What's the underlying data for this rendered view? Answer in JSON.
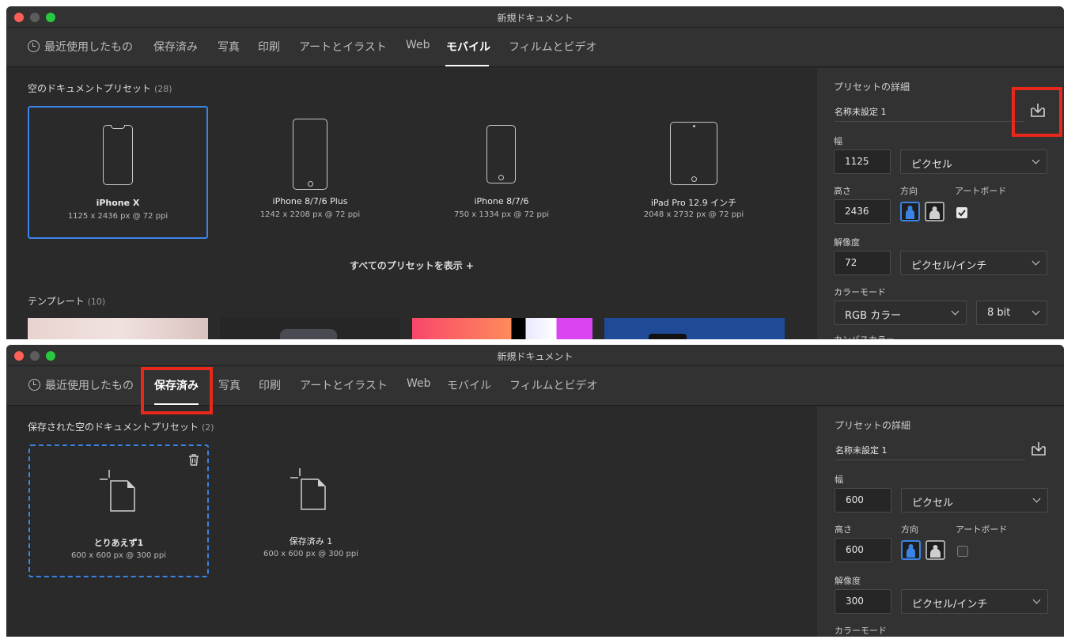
{
  "colors": {
    "accent": "#3a84e6",
    "highlight": "#e8281b"
  },
  "top": {
    "window_title": "新規ドキュメント",
    "tabs": [
      {
        "label": "最近使用したもの"
      },
      {
        "label": "保存済み"
      },
      {
        "label": "写真"
      },
      {
        "label": "印刷"
      },
      {
        "label": "アートとイラスト"
      },
      {
        "label": "Web"
      },
      {
        "label": "モバイル",
        "active": true
      },
      {
        "label": "フィルムとビデオ"
      }
    ],
    "section_title": "空のドキュメントプリセット",
    "section_count": "(28)",
    "presets": [
      {
        "name": "iPhone X",
        "size": "1125 x 2436 px @ 72 ppi",
        "selected": true,
        "icon": "iphone-x-icon"
      },
      {
        "name": "iPhone 8/7/6 Plus",
        "size": "1242 x 2208 px @ 72 ppi",
        "icon": "iphone-plus-icon"
      },
      {
        "name": "iPhone 8/7/6",
        "size": "750 x 1334 px @ 72 ppi",
        "icon": "iphone-icon"
      },
      {
        "name": "iPad Pro 12.9 インチ",
        "size": "2048 x 2732 px @ 72 ppi",
        "icon": "ipad-icon"
      }
    ],
    "show_all": "すべてのプリセットを表示 +",
    "templates_title": "テンプレート",
    "templates_count": "(10)",
    "panel": {
      "title": "プリセットの詳細",
      "name": "名称未設定 1",
      "width_label": "幅",
      "width": "1125",
      "width_unit": "ピクセル",
      "height_label": "高さ",
      "height": "2436",
      "orientation_label": "方向",
      "artboard_label": "アートボード",
      "artboard_checked": true,
      "resolution_label": "解像度",
      "resolution": "72",
      "resolution_unit": "ピクセル/インチ",
      "color_mode_label": "カラーモード",
      "color_mode": "RGB カラー",
      "bit_depth": "8 bit",
      "canvas_color_label": "カンバスカラー"
    }
  },
  "bottom": {
    "window_title": "新規ドキュメント",
    "tabs": [
      {
        "label": "最近使用したもの"
      },
      {
        "label": "保存済み",
        "active": true
      },
      {
        "label": "写真"
      },
      {
        "label": "印刷"
      },
      {
        "label": "アートとイラスト"
      },
      {
        "label": "Web"
      },
      {
        "label": "モバイル"
      },
      {
        "label": "フィルムとビデオ"
      }
    ],
    "section_title": "保存された空のドキュメントプリセット",
    "section_count": "(2)",
    "presets": [
      {
        "name": "とりあえず1",
        "size": "600 x 600 px @ 300 ppi",
        "selected": true
      },
      {
        "name": "保存済み 1",
        "size": "600 x 600 px @ 300 ppi"
      }
    ],
    "panel": {
      "title": "プリセットの詳細",
      "name": "名称未設定 1",
      "width_label": "幅",
      "width": "600",
      "width_unit": "ピクセル",
      "height_label": "高さ",
      "height": "600",
      "orientation_label": "方向",
      "artboard_label": "アートボード",
      "artboard_checked": false,
      "resolution_label": "解像度",
      "resolution": "300",
      "resolution_unit": "ピクセル/インチ",
      "color_mode_label": "カラーモード"
    }
  }
}
